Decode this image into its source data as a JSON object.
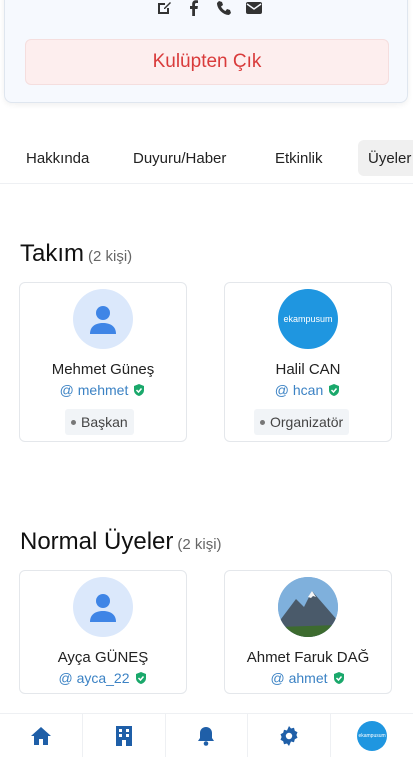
{
  "club": {
    "leave_button": "Kulüpten Çık",
    "contact_icons": [
      "edit-icon",
      "facebook-icon",
      "phone-icon",
      "mail-icon"
    ]
  },
  "tabs": [
    {
      "label": "Hakkında"
    },
    {
      "label": "Duyuru/Haber"
    },
    {
      "label": "Etkinlik"
    },
    {
      "label": "Üyeler",
      "active": true
    }
  ],
  "team": {
    "title": "Takım",
    "count": "(2 kişi)",
    "members": [
      {
        "name": "Mehmet Güneş",
        "handle": "@ mehmet",
        "role": "Başkan",
        "avatar": "default-avatar"
      },
      {
        "name": "Halil CAN",
        "handle": "@ hcan",
        "role": "Organizatör",
        "avatar": "ekampusum-logo",
        "avatar_text": "ekampusum"
      }
    ]
  },
  "regular": {
    "title": "Normal Üyeler",
    "count": "(2 kişi)",
    "members": [
      {
        "name": "Ayça GÜNEŞ",
        "handle": "@ ayca_22",
        "avatar": "default-avatar"
      },
      {
        "name": "Ahmet Faruk DAĞ",
        "handle": "@ ahmet",
        "avatar": "mountain-photo"
      }
    ]
  },
  "bottom_nav": {
    "items": [
      "home-icon",
      "building-icon",
      "bell-icon",
      "gear-icon",
      "profile-avatar"
    ],
    "profile_text": "ekampusum"
  },
  "colors": {
    "accent": "#1f5fa8",
    "danger": "#d93b3b",
    "verified": "#1aa86b"
  }
}
